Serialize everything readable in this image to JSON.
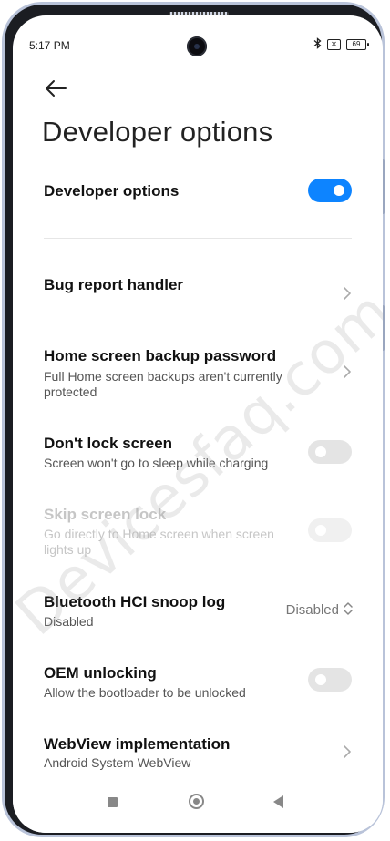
{
  "status": {
    "time": "5:17 PM",
    "battery": "69",
    "sim": "✕"
  },
  "header": {
    "title": "Developer options"
  },
  "master": {
    "label": "Developer options",
    "enabled": true
  },
  "rows": [
    {
      "title": "Bug report handler",
      "subtitle": ""
    },
    {
      "title": "Home screen backup password",
      "subtitle": "Full Home screen backups aren't currently protected"
    },
    {
      "title": "Don't lock screen",
      "subtitle": "Screen won't go to sleep while charging",
      "toggle": false
    },
    {
      "title": "Skip screen lock",
      "subtitle": "Go directly to Home screen when screen lights up",
      "toggle": false,
      "disabled": true
    },
    {
      "title": "Bluetooth HCI snoop log",
      "subtitle": "Disabled",
      "value": "Disabled"
    },
    {
      "title": "OEM unlocking",
      "subtitle": "Allow the bootloader to be unlocked",
      "toggle": false
    },
    {
      "title": "WebView implementation",
      "subtitle": "Android System WebView"
    }
  ],
  "watermark": "Devicesfaq.com",
  "colors": {
    "accent": "#0d84ff",
    "frame": "#b9c3d9"
  }
}
